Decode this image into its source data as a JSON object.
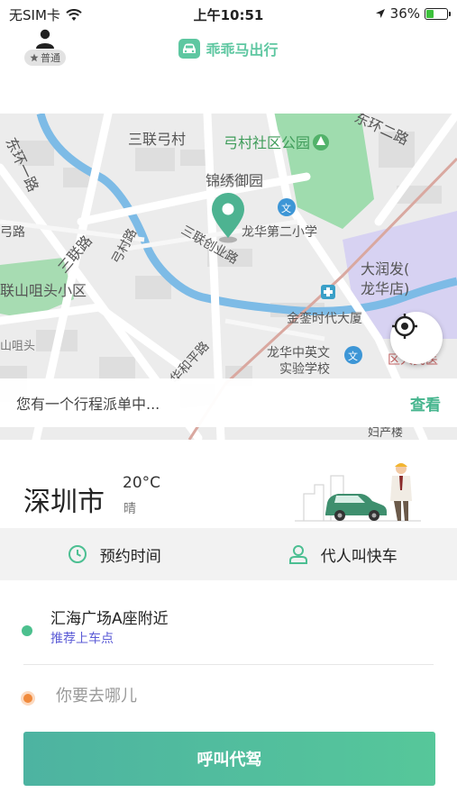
{
  "status_bar": {
    "carrier": "无SIM卡",
    "time": "上午10:51",
    "battery": "36%",
    "battery_level": 0.36,
    "icons": [
      "wifi-icon",
      "location-arrow-icon",
      "battery-icon"
    ]
  },
  "header": {
    "user_level": "普通",
    "brand_name": "乖乖马出行",
    "icons": [
      "avatar-icon",
      "star-icon",
      "car-logo-icon"
    ]
  },
  "map": {
    "labels": [
      "东环一路",
      "三联路",
      "三联弓村",
      "弓村社区公园",
      "东环二路",
      "锦绣御园",
      "龙华第二小学",
      "弓村路",
      "三联创业路",
      "弓路",
      "大润发(",
      "龙华店)",
      "联山咀头小区",
      "金銮时代大厦",
      "山咀头",
      "华和平路",
      "龙华中英文",
      "实验学校",
      "妇产楼",
      "区人民医"
    ],
    "icons": [
      "map-pin-icon",
      "locate-icon",
      "school-icon",
      "park-icon",
      "hospital-icon"
    ]
  },
  "trip": {
    "message": "您有一个行程派单中...",
    "action": "查看"
  },
  "weather": {
    "city": "深圳市",
    "temperature": "20°C",
    "condition": "晴"
  },
  "options": {
    "schedule": "预约时间",
    "proxy": "代人叫快车",
    "icons": [
      "clock-icon",
      "person-icon"
    ]
  },
  "route": {
    "pickup": "汇海广场A座附近",
    "pickup_hint": "推荐上车点",
    "destination_placeholder": "你要去哪儿"
  },
  "actions": {
    "call": "呼叫代驾"
  },
  "colors": {
    "accent": "#5ec7a1",
    "link": "#5b5bd6",
    "pickup_dot": "#4cc08e",
    "dest_dot": "#f08a3c"
  }
}
